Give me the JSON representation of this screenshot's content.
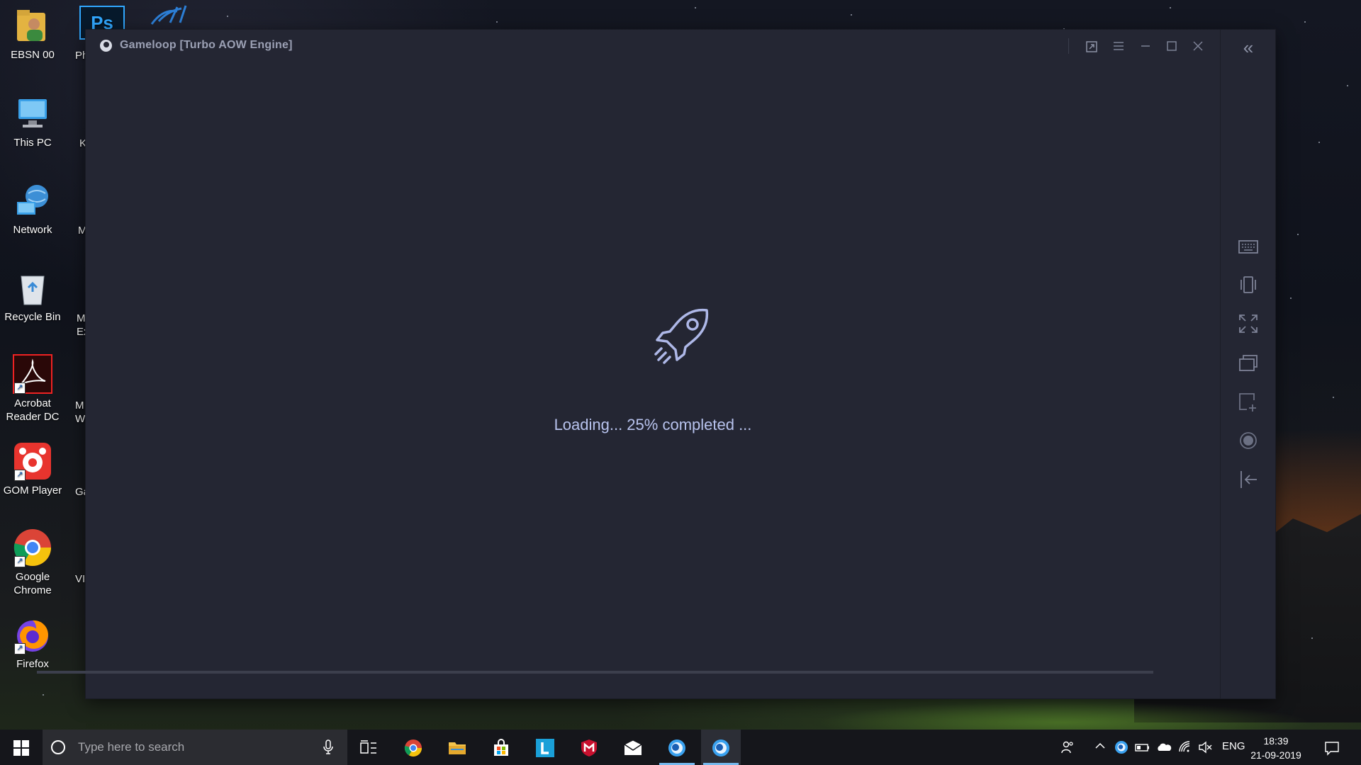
{
  "desktop": {
    "icons": [
      {
        "label": "EBSN 00"
      },
      {
        "label": "This PC"
      },
      {
        "label": "Network"
      },
      {
        "label": "Recycle Bin"
      },
      {
        "label": "Acrobat Reader DC"
      },
      {
        "label": "GOM Player"
      },
      {
        "label": "Google Chrome"
      },
      {
        "label": "Firefox"
      }
    ],
    "partial_labels": [
      "Ph",
      "K",
      "M",
      "M Ex",
      "M W",
      "Ga",
      "VI"
    ]
  },
  "window": {
    "title": "Gameloop  [Turbo AOW Engine]",
    "loading_text": "Loading... 25% completed ...",
    "progress_percent": 25,
    "titlebar_buttons": [
      "popout-icon",
      "menu-icon",
      "minimize-icon",
      "maximize-icon",
      "close-icon"
    ],
    "sidebar_buttons": [
      "keyboard-icon",
      "shake-icon",
      "fullscreen-icon",
      "multi-window-icon",
      "screenshot-icon",
      "record-icon",
      "exit-icon"
    ]
  },
  "taskbar": {
    "search_placeholder": "Type here to search",
    "apps": [
      "task-view",
      "chrome",
      "file-explorer",
      "microsoft-store",
      "l-app",
      "mcafee",
      "mail",
      "gameloop",
      "gameloop-active"
    ],
    "language": "ENG",
    "time": "18:39",
    "date": "21-09-2019",
    "accent_color": "#76b9ed"
  }
}
